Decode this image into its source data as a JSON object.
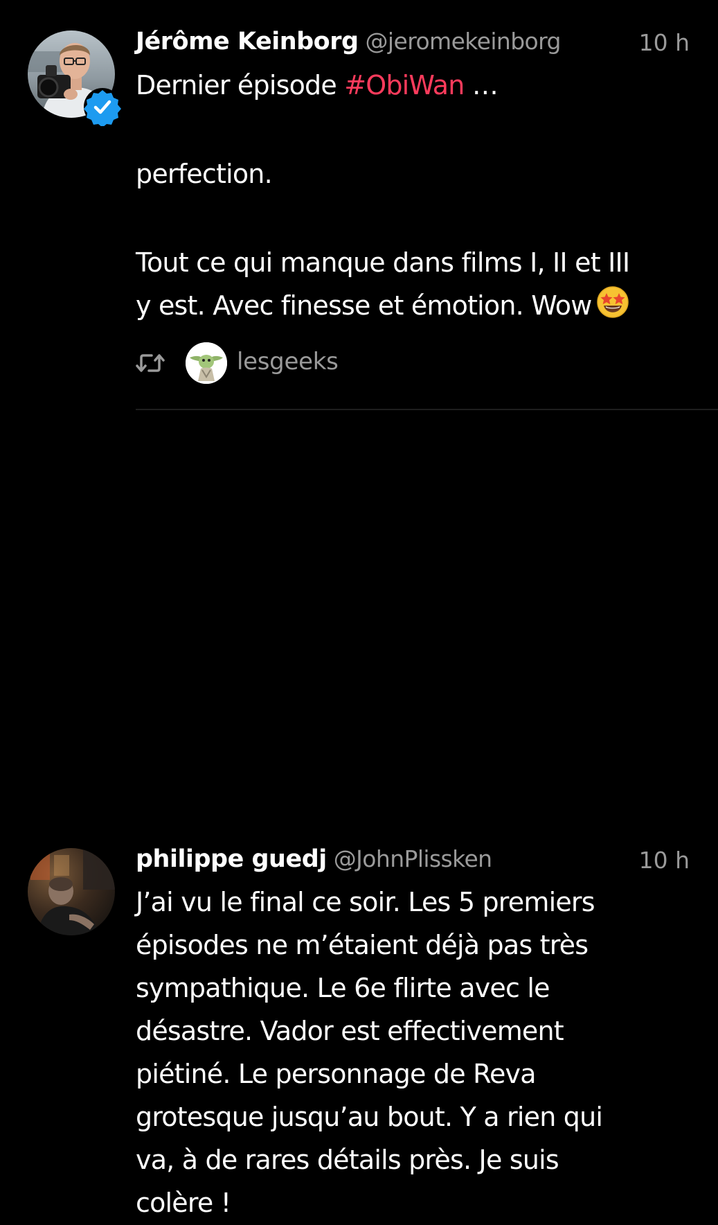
{
  "tweets": [
    {
      "name": "Jérôme Keinborg",
      "handle": "@jeromekeinborg",
      "time": "10 h",
      "verified": true,
      "text": {
        "line1_prefix": "Dernier épisode ",
        "hashtag": "#ObiWan",
        "line1_suffix": " …",
        "line2": "perfection.",
        "line3": "Tout ce qui manque dans films I, II et III",
        "line4": "y est. Avec finesse et émotion. Wow"
      },
      "emoji": "star-struck-emoji",
      "retweeted_by": "lesgeeks"
    },
    {
      "name": "philippe guedj",
      "handle": "@JohnPlissken",
      "time": "10 h",
      "verified": false,
      "lines": [
        "J’ai vu le final ce soir. Les 5 premiers",
        "épisodes ne m’étaient déjà pas très",
        "sympathique. Le 6e flirte avec le",
        "désastre. Vador est effectivement",
        "piétiné. Le personnage de Reva",
        "grotesque jusqu’au bout. Y a rien qui",
        "va, à de rares détails près. Je suis",
        "colère !"
      ]
    }
  ],
  "colors": {
    "background": "#000000",
    "text": "#ffffff",
    "secondary_text": "#9a9a9a",
    "hashtag": "#ff3b5c",
    "verified_badge": "#1d9bf0",
    "divider": "#1e1e1e"
  }
}
